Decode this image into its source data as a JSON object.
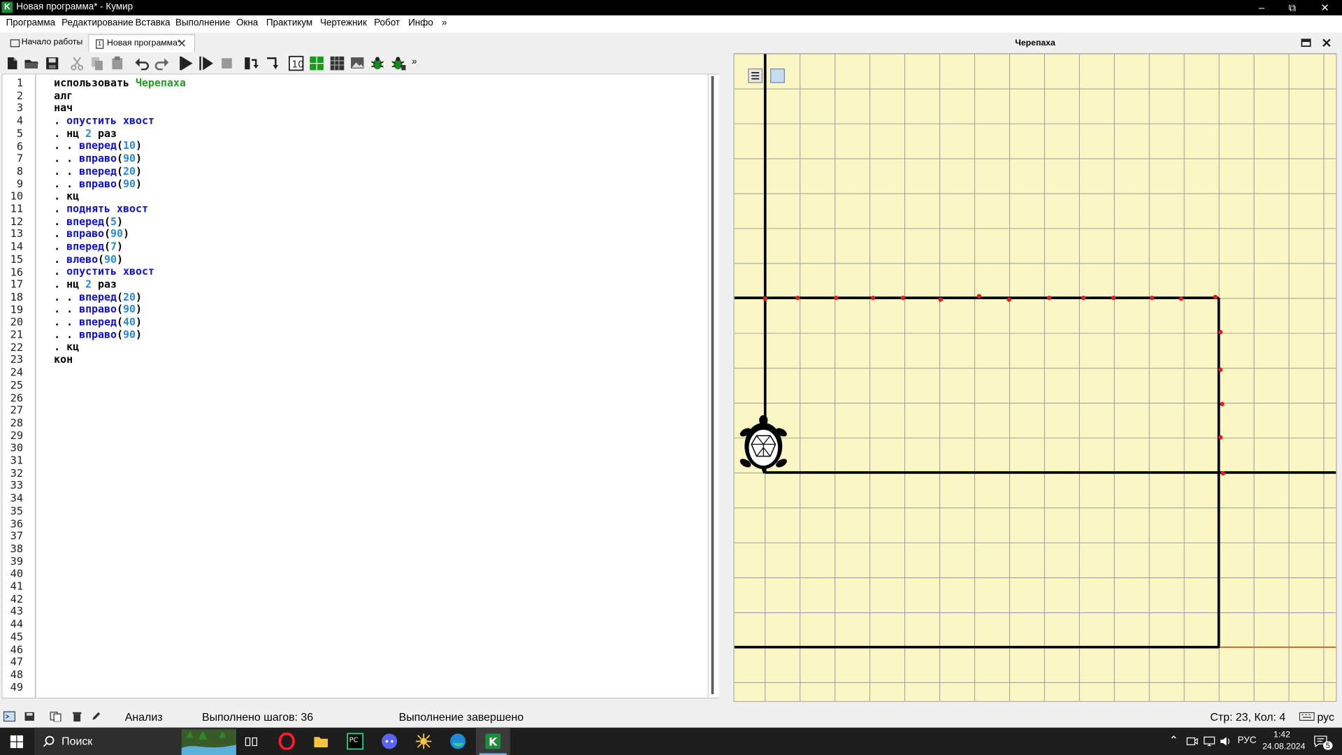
{
  "window": {
    "title": "Новая программа* - Кумир",
    "app_icon_letter": "K"
  },
  "menu": [
    "Программа",
    "Редактирование",
    "Вставка",
    "Выполнение",
    "Окна",
    "Практикум",
    "Чертежник",
    "Робот",
    "Инфо",
    "»"
  ],
  "tabs": [
    {
      "label": "Начало работы",
      "active": false
    },
    {
      "label": "Новая программа*",
      "active": true
    }
  ],
  "toolbar": {
    "icons": [
      "new-file-icon",
      "open-folder-icon",
      "save-icon",
      "cut-icon",
      "copy-icon",
      "paste-icon",
      "undo-icon",
      "redo-icon",
      "run-icon",
      "step-run-icon",
      "stop-icon",
      "step-over-icon",
      "step-into-icon",
      "variables-icon",
      "grid-green-icon",
      "table-icon",
      "image-edit-icon",
      "debug-bug-icon",
      "debug-step-bug-icon"
    ],
    "more": "»"
  },
  "editor": {
    "total_lines": 49,
    "code": [
      [
        [
          "kw",
          "использовать "
        ],
        [
          "grn",
          "Черепаха"
        ]
      ],
      [
        [
          "kw",
          "алг"
        ]
      ],
      [
        [
          "kw",
          "нач"
        ]
      ],
      [
        [
          "dot",
          ". "
        ],
        [
          "fn",
          "опустить хвост"
        ]
      ],
      [
        [
          "dot",
          ". "
        ],
        [
          "kw",
          "нц "
        ],
        [
          "num",
          "2"
        ],
        [
          "kw",
          " раз"
        ]
      ],
      [
        [
          "dot",
          ". . "
        ],
        [
          "fn",
          "вперед"
        ],
        [
          "kw",
          "("
        ],
        [
          "num",
          "10"
        ],
        [
          "kw",
          ")"
        ]
      ],
      [
        [
          "dot",
          ". . "
        ],
        [
          "fn",
          "вправо"
        ],
        [
          "kw",
          "("
        ],
        [
          "num",
          "90"
        ],
        [
          "kw",
          ")"
        ]
      ],
      [
        [
          "dot",
          ". . "
        ],
        [
          "fn",
          "вперед"
        ],
        [
          "kw",
          "("
        ],
        [
          "num",
          "20"
        ],
        [
          "kw",
          ")"
        ]
      ],
      [
        [
          "dot",
          ". . "
        ],
        [
          "fn",
          "вправо"
        ],
        [
          "kw",
          "("
        ],
        [
          "num",
          "90"
        ],
        [
          "kw",
          ")"
        ]
      ],
      [
        [
          "dot",
          ". "
        ],
        [
          "kw",
          "кц"
        ]
      ],
      [
        [
          "dot",
          ". "
        ],
        [
          "fn",
          "поднять хвост"
        ]
      ],
      [
        [
          "dot",
          ". "
        ],
        [
          "fn",
          "вперед"
        ],
        [
          "kw",
          "("
        ],
        [
          "num",
          "5"
        ],
        [
          "kw",
          ")"
        ]
      ],
      [
        [
          "dot",
          ". "
        ],
        [
          "fn",
          "вправо"
        ],
        [
          "kw",
          "("
        ],
        [
          "num",
          "90"
        ],
        [
          "kw",
          ")"
        ]
      ],
      [
        [
          "dot",
          ". "
        ],
        [
          "fn",
          "вперед"
        ],
        [
          "kw",
          "("
        ],
        [
          "num",
          "7"
        ],
        [
          "kw",
          ")"
        ]
      ],
      [
        [
          "dot",
          ". "
        ],
        [
          "fn",
          "влево"
        ],
        [
          "kw",
          "("
        ],
        [
          "num",
          "90"
        ],
        [
          "kw",
          ")"
        ]
      ],
      [
        [
          "dot",
          ". "
        ],
        [
          "fn",
          "опустить хвост"
        ]
      ],
      [
        [
          "dot",
          ". "
        ],
        [
          "kw",
          "нц "
        ],
        [
          "num",
          "2"
        ],
        [
          "kw",
          " раз"
        ]
      ],
      [
        [
          "dot",
          ". . "
        ],
        [
          "fn",
          "вперед"
        ],
        [
          "kw",
          "("
        ],
        [
          "num",
          "20"
        ],
        [
          "kw",
          ")"
        ]
      ],
      [
        [
          "dot",
          ". . "
        ],
        [
          "fn",
          "вправо"
        ],
        [
          "kw",
          "("
        ],
        [
          "num",
          "90"
        ],
        [
          "kw",
          ")"
        ]
      ],
      [
        [
          "dot",
          ". . "
        ],
        [
          "fn",
          "вперед"
        ],
        [
          "kw",
          "("
        ],
        [
          "num",
          "40"
        ],
        [
          "kw",
          ")"
        ]
      ],
      [
        [
          "dot",
          ". . "
        ],
        [
          "fn",
          "вправо"
        ],
        [
          "kw",
          "("
        ],
        [
          "num",
          "90"
        ],
        [
          "kw",
          ")"
        ]
      ],
      [
        [
          "dot",
          ". "
        ],
        [
          "kw",
          "кц"
        ]
      ],
      [
        [
          "kw",
          "кон"
        ]
      ]
    ]
  },
  "turtle_panel": {
    "title": "Черепаха",
    "grid_bg": "#fbf7c5",
    "line_color": "#000000",
    "point_color": "#e02020"
  },
  "status": {
    "mode": "Анализ",
    "steps": "Выполнено шагов: 36",
    "state": "Выполнение завершено",
    "position": "Стр: 23, Кол: 4",
    "lang": "рус"
  },
  "taskbar": {
    "search": "Поиск",
    "lang": "РУС",
    "time": "1:42",
    "date": "24.08.2024",
    "notifications": "5"
  }
}
